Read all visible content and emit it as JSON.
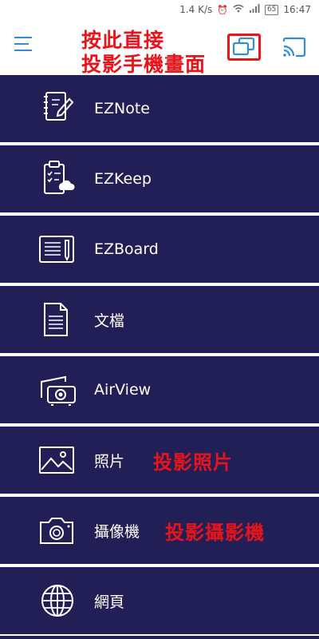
{
  "status_bar": {
    "speed": "1.4 K/s",
    "battery": "65",
    "time": "16:47"
  },
  "header": {
    "annotation_line1": "按此直接",
    "annotation_line2": "投影手機畫面",
    "annotation_color": "#e8141b",
    "accent_color": "#2e8fd6"
  },
  "menu": {
    "background_color": "#211f56",
    "items": [
      {
        "label": "EZNote",
        "icon": "notebook-pen-icon"
      },
      {
        "label": "EZKeep",
        "icon": "clipboard-cloud-icon"
      },
      {
        "label": "EZBoard",
        "icon": "whiteboard-pen-icon"
      },
      {
        "label": "文檔",
        "icon": "document-icon"
      },
      {
        "label": "AirView",
        "icon": "projector-icon"
      },
      {
        "label": "照片",
        "icon": "photo-icon",
        "note": "投影照片"
      },
      {
        "label": "攝像機",
        "icon": "camera-icon",
        "note": "投影攝影機"
      },
      {
        "label": "網頁",
        "icon": "globe-icon"
      }
    ]
  }
}
